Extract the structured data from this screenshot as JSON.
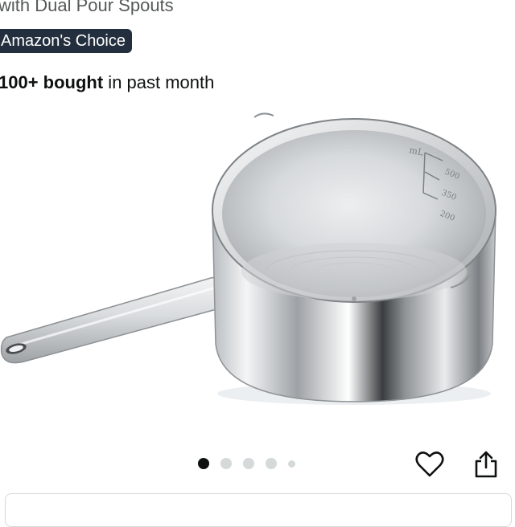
{
  "product": {
    "subtitle": "with Dual Pour Spouts",
    "badge": "Amazon's Choice",
    "bought_count": "100+ bought",
    "bought_suffix": " in past month",
    "image_alt": "Stainless steel saucepan with measurement markings",
    "pan_markings": [
      "mL",
      "500",
      "350",
      "200"
    ]
  },
  "carousel": {
    "total": 5,
    "active_index": 0
  },
  "actions": {
    "favorite_icon": "heart-icon",
    "share_icon": "share-icon"
  },
  "colors": {
    "badge_bg": "#232f3e",
    "text": "#0f1111",
    "muted": "#565959",
    "dot_inactive": "#d5d9d9"
  }
}
